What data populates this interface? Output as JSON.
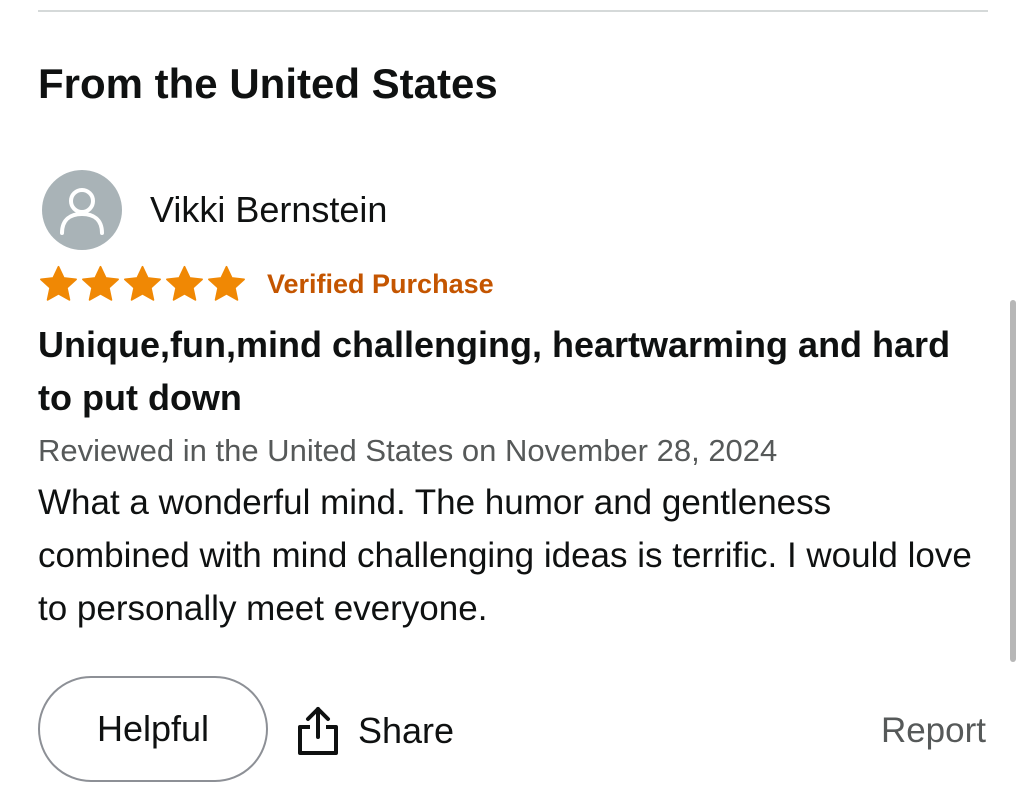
{
  "section": {
    "title": "From the United States"
  },
  "review": {
    "reviewer_name": "Vikki Bernstein",
    "rating": 5,
    "rating_max": 5,
    "verified_label": "Verified Purchase",
    "title": "Unique,fun,mind challenging, heartwarming and hard to put down",
    "meta": "Reviewed in the United States on November 28, 2024",
    "body": "What a wonderful mind. The humor and gentleness combined with mind challenging ideas is terrific. I would love to personally meet everyone."
  },
  "actions": {
    "helpful_label": "Helpful",
    "share_label": "Share",
    "report_label": "Report"
  },
  "icons": {
    "avatar": "user-icon",
    "star": "star-icon",
    "share": "share-icon"
  },
  "colors": {
    "star": "#f08804",
    "verified": "#c45500",
    "avatar_bg": "#a9b3b7",
    "meta_text": "#565959"
  }
}
